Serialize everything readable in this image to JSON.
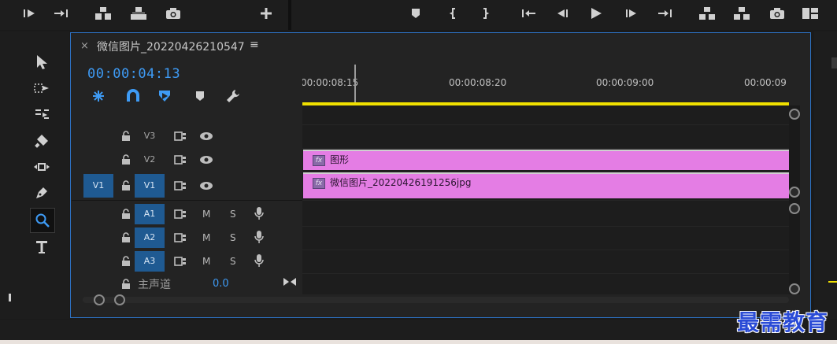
{
  "window": {
    "tab_close": "×",
    "tab_title": "微信图片_20220426210547",
    "tab_menu": "≡"
  },
  "timeline": {
    "timecode": "00:00:04:13",
    "ruler_ticks": [
      "00:00:08:15",
      "00:00:08:20",
      "00:00:09:00",
      "00:00:09"
    ],
    "tracks": {
      "v3": {
        "label": "V3"
      },
      "v2": {
        "label": "V2"
      },
      "v1": {
        "label": "V1",
        "source": "V1"
      },
      "a1": {
        "label": "A1",
        "mute": "M",
        "solo": "S"
      },
      "a2": {
        "label": "A2",
        "mute": "M",
        "solo": "S"
      },
      "a3": {
        "label": "A3",
        "mute": "M",
        "solo": "S"
      }
    },
    "master": {
      "label": "主声道",
      "value": "0.0"
    },
    "clips": {
      "graphic": {
        "fx": "fx",
        "name": "图形"
      },
      "image": {
        "fx": "fx",
        "name": "微信图片_20220426191256jpg"
      }
    }
  },
  "watermark": "最需教育",
  "colors": {
    "accent": "#3e9bf5",
    "panel_border": "#2d72c4",
    "clip": "#e47de4",
    "work_area": "#f0e000",
    "track_target": "#1f5a92"
  }
}
